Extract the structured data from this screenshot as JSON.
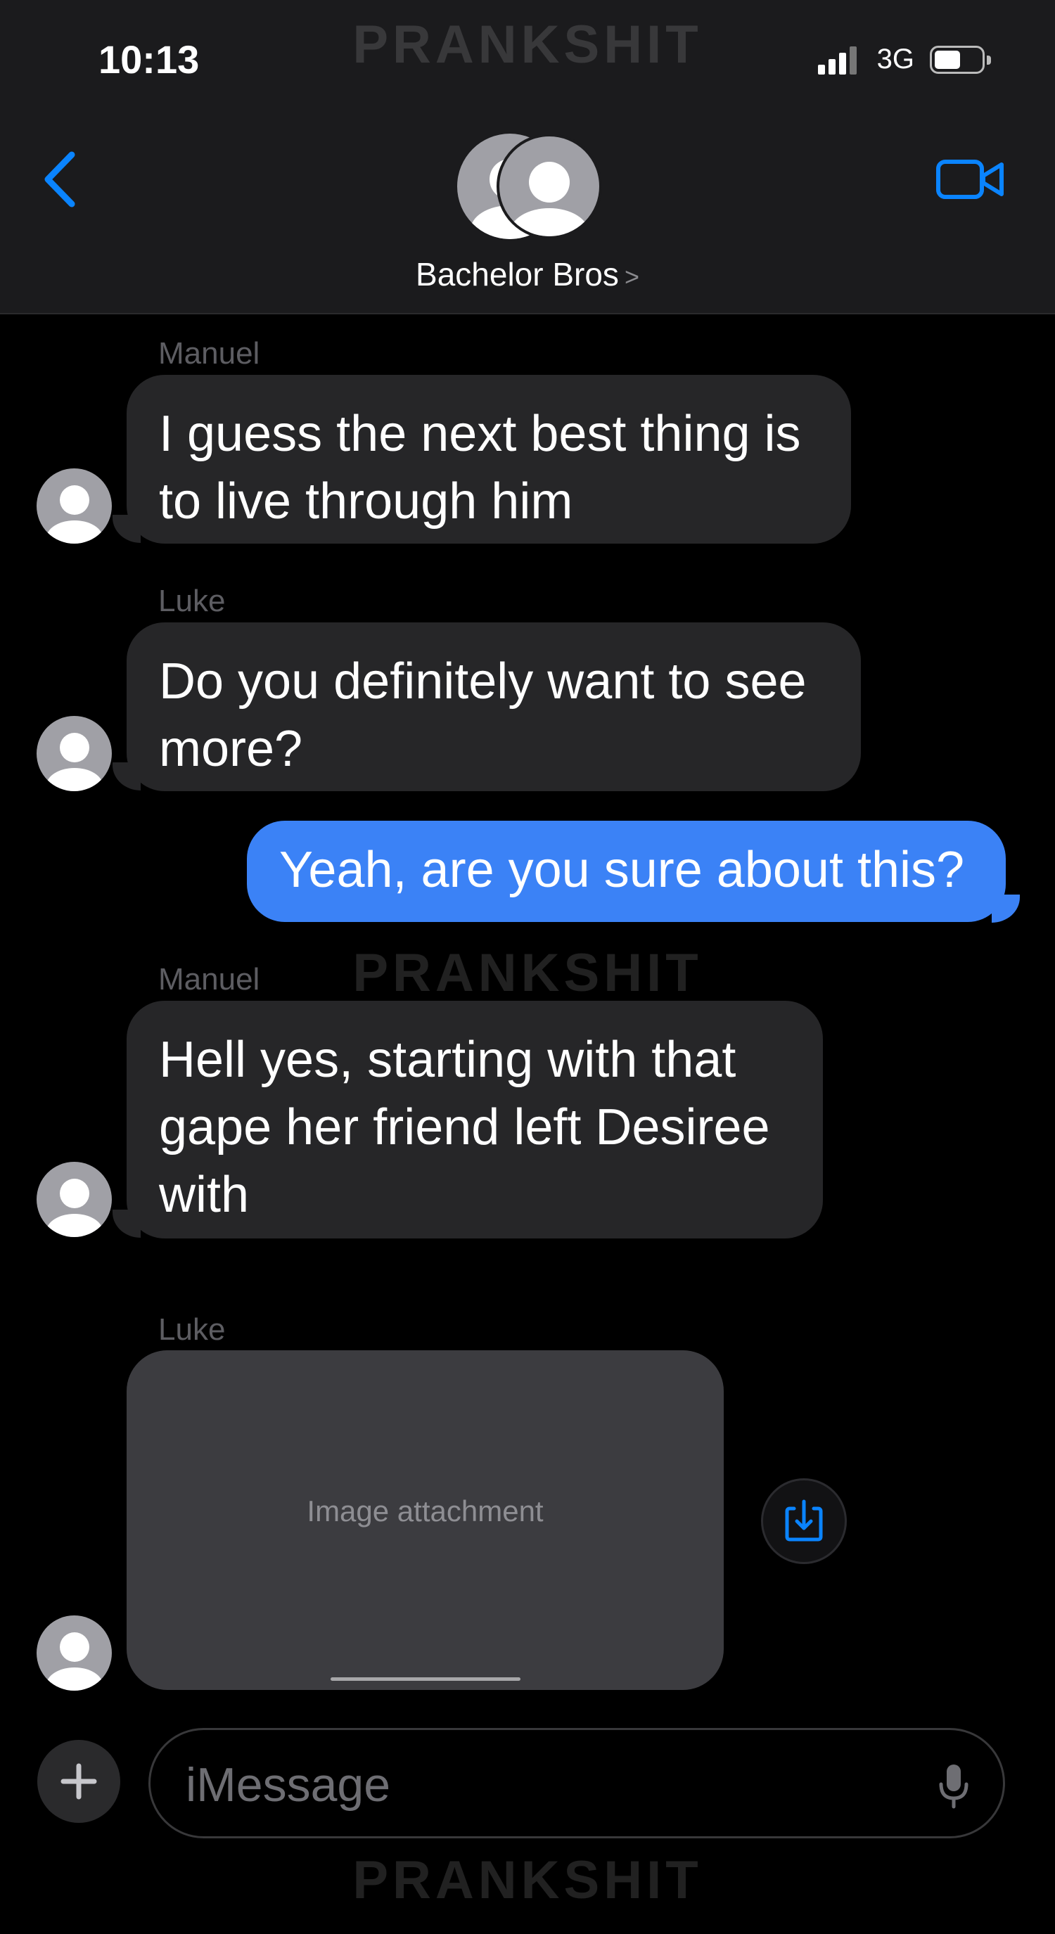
{
  "status_bar": {
    "time": "10:13",
    "network": "3G"
  },
  "header": {
    "group_name": "Bachelor Bros",
    "group_chevron": ">"
  },
  "watermark": "PRANKSHIT",
  "messages": [
    {
      "sender": "Manuel",
      "direction": "incoming",
      "lines": [
        "I guess the next best thing is",
        "to live through him"
      ]
    },
    {
      "sender": "Luke",
      "direction": "incoming",
      "lines": [
        "Do you definitely want to see",
        "more?"
      ]
    },
    {
      "sender": "",
      "direction": "outgoing",
      "lines": [
        "Yeah, are you sure about this?"
      ]
    },
    {
      "sender": "Manuel",
      "direction": "incoming",
      "lines": [
        "Hell yes, starting with that",
        "gape her friend left Desiree",
        "with"
      ]
    },
    {
      "sender": "Luke",
      "direction": "incoming",
      "attachment": "image",
      "placeholder": "Image attachment"
    }
  ],
  "composer": {
    "placeholder": "iMessage"
  },
  "colors": {
    "accent": "#0a84ff",
    "outgoing_bubble": "#3b82f6",
    "incoming_bubble": "#262628",
    "header_bg": "#1b1b1d"
  },
  "icons": [
    "back-chevron-icon",
    "video-camera-icon",
    "group-avatar-icon",
    "contact-avatar-icon",
    "share-icon",
    "plus-icon",
    "microphone-icon"
  ]
}
